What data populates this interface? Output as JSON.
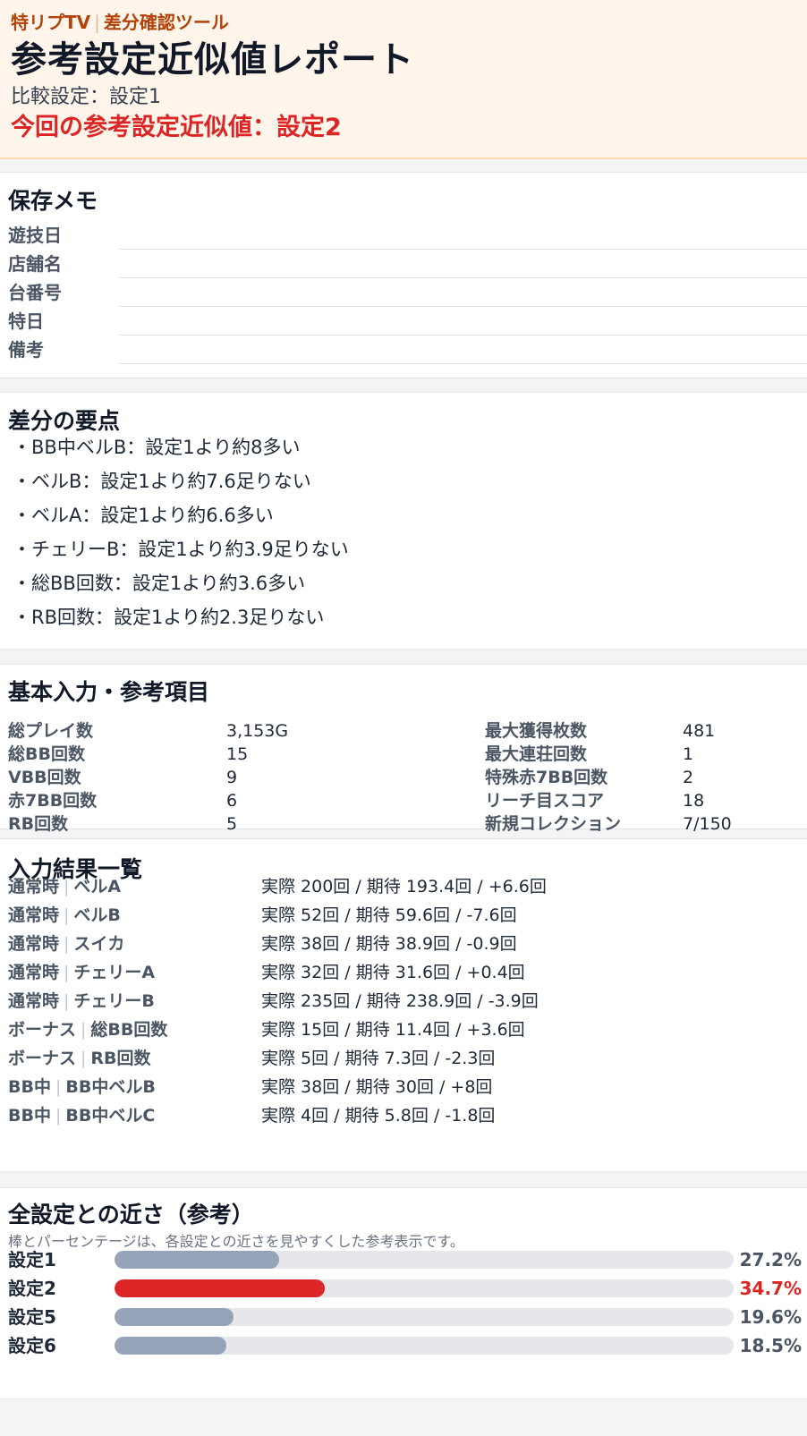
{
  "header": {
    "brand": "特リプTV",
    "tool": "差分確認ツール",
    "title": "参考設定近似値レポート",
    "compare": "比較設定：設定1",
    "result": "今回の参考設定近似値：設定2"
  },
  "memo": {
    "title": "保存メモ",
    "fields": [
      {
        "label": "遊技日",
        "value": ""
      },
      {
        "label": "店舗名",
        "value": ""
      },
      {
        "label": "台番号",
        "value": ""
      },
      {
        "label": "特日",
        "value": ""
      },
      {
        "label": "備考",
        "value": ""
      }
    ]
  },
  "points": {
    "title": "差分の要点",
    "items": [
      "・BB中ベルB：設定1より約8多い",
      "・ベルB：設定1より約7.6足りない",
      "・ベルA：設定1より約6.6多い",
      "・チェリーB：設定1より約3.9足りない",
      "・総BB回数：設定1より約3.6多い",
      "・RB回数：設定1より約2.3足りない"
    ]
  },
  "basic": {
    "title": "基本入力・参考項目",
    "left": [
      {
        "label": "総プレイ数",
        "value": "3,153G"
      },
      {
        "label": "総BB回数",
        "value": "15"
      },
      {
        "label": "VBB回数",
        "value": "9"
      },
      {
        "label": "赤7BB回数",
        "value": "6"
      },
      {
        "label": "RB回数",
        "value": "5"
      }
    ],
    "right": [
      {
        "label": "最大獲得枚数",
        "value": "481"
      },
      {
        "label": "最大連荘回数",
        "value": "1"
      },
      {
        "label": "特殊赤7BB回数",
        "value": "2"
      },
      {
        "label": "リーチ目スコア",
        "value": "18"
      },
      {
        "label": "新規コレクション",
        "value": "7/150"
      }
    ]
  },
  "results": {
    "title": "入力結果一覧",
    "rows": [
      {
        "group": "通常時",
        "item": "ベルA",
        "value": "実際 200回 / 期待 193.4回 / +6.6回"
      },
      {
        "group": "通常時",
        "item": "ベルB",
        "value": "実際 52回 / 期待 59.6回 / -7.6回"
      },
      {
        "group": "通常時",
        "item": "スイカ",
        "value": "実際 38回 / 期待 38.9回 / -0.9回"
      },
      {
        "group": "通常時",
        "item": "チェリーA",
        "value": "実際 32回 / 期待 31.6回 / +0.4回"
      },
      {
        "group": "通常時",
        "item": "チェリーB",
        "value": "実際 235回 / 期待 238.9回 / -3.9回"
      },
      {
        "group": "ボーナス",
        "item": "総BB回数",
        "value": "実際 15回 / 期待 11.4回 / +3.6回"
      },
      {
        "group": "ボーナス",
        "item": "RB回数",
        "value": "実際 5回 / 期待 7.3回 / -2.3回"
      },
      {
        "group": "BB中",
        "item": "BB中ベルB",
        "value": "実際 38回 / 期待 30回 / +8回"
      },
      {
        "group": "BB中",
        "item": "BB中ベルC",
        "value": "実際 4回 / 期待 5.8回 / -1.8回"
      }
    ]
  },
  "closeness": {
    "title": "全設定との近さ（参考）",
    "note": "棒とパーセンテージは、各設定との近さを見やすくした参考表示です。",
    "highlight_color": "#dc2626",
    "normal_color": "#94a3b8",
    "rows": [
      {
        "label": "設定1",
        "pct_text": "27.2%",
        "level": 27.2,
        "highlight": false
      },
      {
        "label": "設定2",
        "pct_text": "34.7%",
        "level": 34.7,
        "highlight": true
      },
      {
        "label": "設定5",
        "pct_text": "19.6%",
        "level": 19.6,
        "highlight": false
      },
      {
        "label": "設定6",
        "pct_text": "18.5%",
        "level": 18.5,
        "highlight": false
      }
    ]
  }
}
